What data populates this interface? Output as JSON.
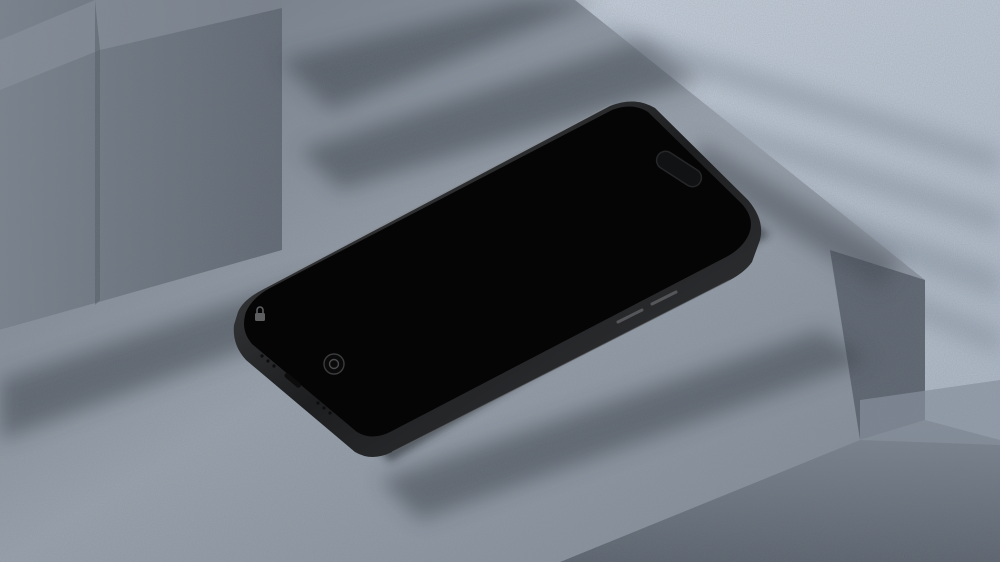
{
  "scene": {
    "colors": {
      "wall": "#c7d2df",
      "concrete_top": "#8e97a3",
      "concrete_side": "#717a86",
      "concrete_dark": "#4f5660",
      "shadow": "#3c434c",
      "phone_frame": "#2b2c2e",
      "phone_screen": "#050505"
    },
    "icons": [
      "lock-icon",
      "camera-icon"
    ]
  }
}
